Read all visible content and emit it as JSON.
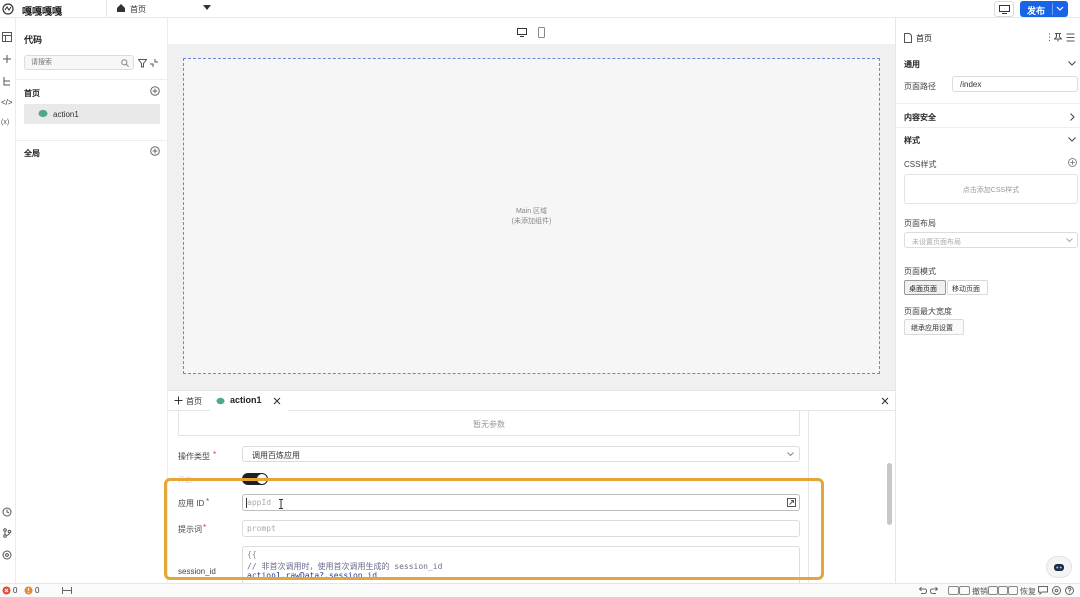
{
  "app": {
    "name": "嘎嘎嘎嘎",
    "current_page": "首页",
    "publish_label": "发布"
  },
  "canvas": {
    "main_label": "Main 区域",
    "main_hint": "(未添加组件)"
  },
  "left": {
    "title": "代码",
    "search_placeholder": "请搜索",
    "section_home": "首页",
    "item_action": "action1",
    "section_global": "全局"
  },
  "tabs": {
    "home": "首页",
    "action": "action1"
  },
  "action": {
    "no_params": "暂无参数",
    "op_type_label": "操作类型",
    "op_type_value": "调用百炼应用",
    "hidden_label": "开启",
    "app_id_label": "应用 ID",
    "app_id_placeholder": "appId",
    "prompt_label": "提示词",
    "prompt_placeholder": "prompt",
    "session_label": "session_id",
    "session_line1": "{{",
    "session_line2": "// 非首次调用时，使用首次调用生成的 session_id",
    "session_line3": "action1.rawData?.session_id"
  },
  "right": {
    "title": "首页",
    "general": "通用",
    "page_path_label": "页面路径",
    "page_path_value": "/index",
    "content_safety": "内容安全",
    "style": "样式",
    "css_style": "CSS样式",
    "css_add": "点击添加CSS样式",
    "layout": "页面布局",
    "layout_placeholder": "未设置页面布局",
    "mode": "页面模式",
    "mode_desktop": "桌面页面",
    "mode_mobile": "移动页面",
    "max_width": "页面最大宽度",
    "inherit": "继承应用设置"
  },
  "status": {
    "errors": "0",
    "warnings": "0",
    "undo": "撤销",
    "redo": "恢复"
  },
  "colors": {
    "accent": "#1764e8",
    "highlight": "#e4a63a",
    "toggle": "#1f1f1f"
  }
}
